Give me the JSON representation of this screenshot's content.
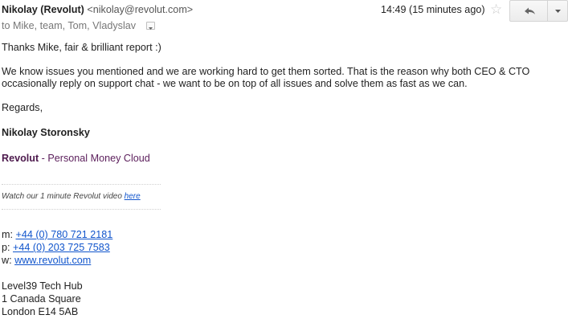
{
  "header": {
    "sender_name": "Nikolay (Revolut)",
    "sender_email": "<nikolay@revolut.com>",
    "timestamp": "14:49 (15 minutes ago)",
    "recipients": "to Mike, team, Tom, Vladyslav"
  },
  "body": {
    "greeting": "Thanks Mike, fair & brilliant report :)",
    "para_line1": "We know issues you mentioned and we are working hard to get them sorted. That is the reason why both CEO & CTO",
    "para_line2": "occasionally reply on support chat -  we want to be on top of all issues and solve them as fast as we can.",
    "signoff": "Regards,"
  },
  "signature": {
    "name": "Nikolay Storonsky",
    "brand": "Revolut",
    "tagline": " - Personal Money Cloud",
    "video_text": "Watch our 1 minute Revolut video ",
    "video_link": "here",
    "mobile_label": "m: ",
    "mobile": "+44 (0) 780 721 2181",
    "phone_label": "p: ",
    "phone": "+44 (0) 203 725 7583",
    "web_label": "w: ",
    "web": "www.revolut.com",
    "address": [
      "Level39 Tech Hub",
      "1 Canada Square",
      "London E14 5AB"
    ]
  },
  "icons": {
    "star": "star-icon",
    "reply": "reply-arrow-icon",
    "more": "dropdown-caret-icon",
    "recipients_toggle": "expand-caret-icon"
  },
  "colors": {
    "link": "#1155cc",
    "brand": "#4d1a4d"
  }
}
